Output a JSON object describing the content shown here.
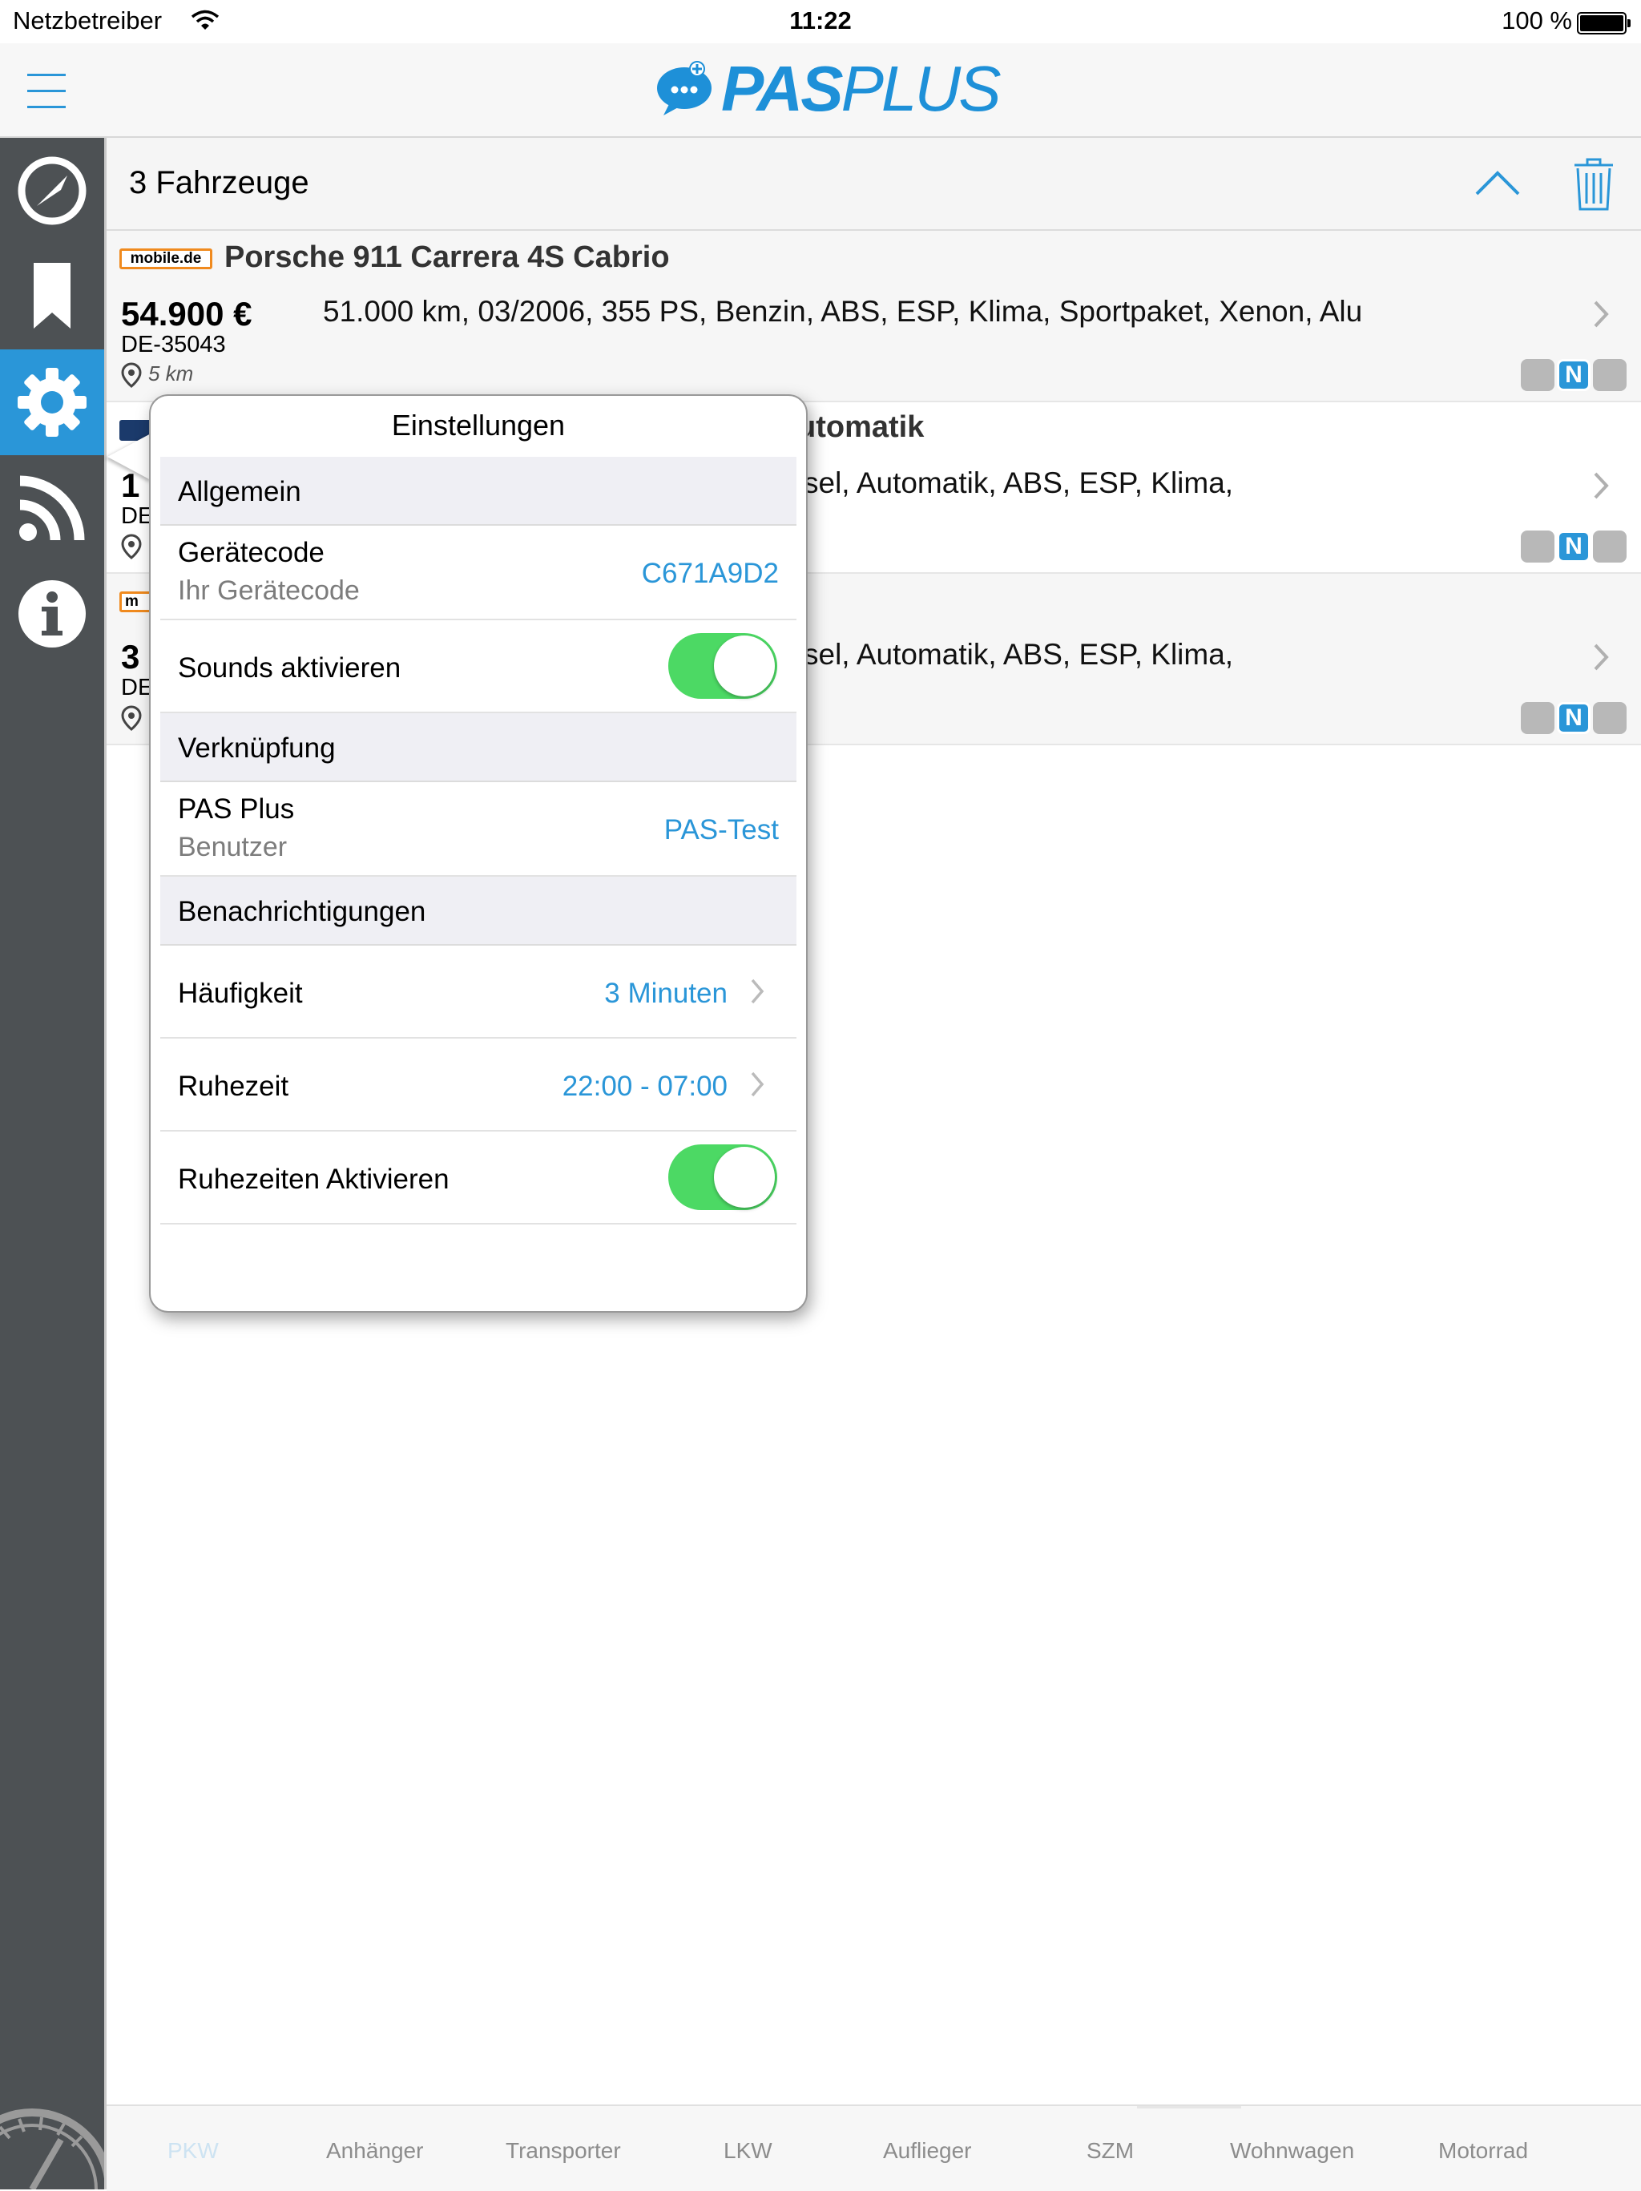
{
  "status_bar": {
    "carrier": "Netzbetreiber",
    "time": "11:22",
    "battery": "100 %"
  },
  "app": {
    "logo_pas": "PAS",
    "logo_plus": "PLUS",
    "brand_color": "#1e90d8"
  },
  "sidebar": {
    "items": [
      {
        "name": "dashboard",
        "icon": "compass-icon",
        "active": false
      },
      {
        "name": "bookmarks",
        "icon": "bookmark-icon",
        "active": false
      },
      {
        "name": "settings",
        "icon": "gear-icon",
        "active": true
      },
      {
        "name": "feeds",
        "icon": "rss-icon",
        "active": false
      },
      {
        "name": "info",
        "icon": "info-icon",
        "active": false
      }
    ]
  },
  "list": {
    "count_label": "3 Fahrzeuge",
    "vehicles": [
      {
        "source": "mobile.de",
        "title": "Porsche 911 Carrera 4S Cabrio",
        "price": "54.900 €",
        "zip": "DE-35043",
        "distance": "5 km",
        "description": "51.000 km, 03/2006, 355 PS, Benzin, ABS, ESP, Klima, Sportpaket, Xenon, Alu"
      },
      {
        "source": "",
        "title": "utomatik",
        "price": "1",
        "zip": "DE",
        "distance": "",
        "description": "sel, Automatik, ABS, ESP, Klima,"
      },
      {
        "source": "m",
        "title": "",
        "price": "3",
        "zip": "DE",
        "distance": "",
        "description": "sel, Automatik, ABS, ESP, Klima,"
      }
    ],
    "status_chip_label": "N"
  },
  "settings_popover": {
    "title": "Einstellungen",
    "sections": {
      "general": "Allgemein",
      "link": "Verknüpfung",
      "notifications": "Benachrichtigungen"
    },
    "device_code": {
      "label": "Gerätecode",
      "sublabel": "Ihr Gerätecode",
      "value": "C671A9D2"
    },
    "sounds": {
      "label": "Sounds aktivieren",
      "enabled": true
    },
    "pas_plus": {
      "label": "PAS Plus",
      "sublabel": "Benutzer",
      "value": "PAS-Test"
    },
    "frequency": {
      "label": "Häufigkeit",
      "value": "3 Minuten"
    },
    "quiet_time": {
      "label": "Ruhezeit",
      "value": "22:00 - 07:00"
    },
    "quiet_enabled": {
      "label": "Ruhezeiten Aktivieren",
      "enabled": true
    },
    "toggle_color": "#4cd964"
  },
  "tabs": [
    "PKW",
    "Anhänger",
    "Transporter",
    "LKW",
    "Auflieger",
    "SZM",
    "Wohnwagen",
    "Motorrad"
  ],
  "active_tab": "PKW"
}
